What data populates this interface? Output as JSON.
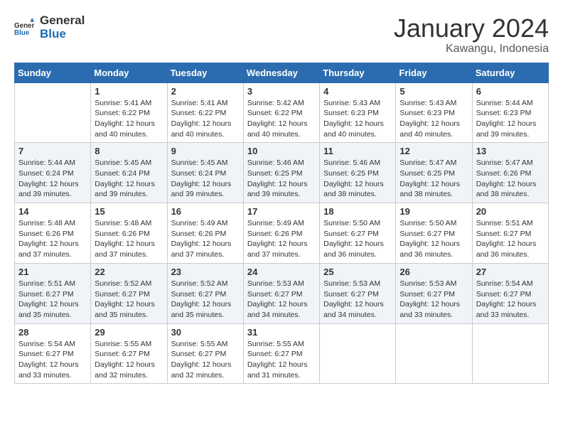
{
  "header": {
    "logo_general": "General",
    "logo_blue": "Blue",
    "month_year": "January 2024",
    "location": "Kawangu, Indonesia"
  },
  "days_of_week": [
    "Sunday",
    "Monday",
    "Tuesday",
    "Wednesday",
    "Thursday",
    "Friday",
    "Saturday"
  ],
  "weeks": [
    [
      {
        "day": "",
        "info": ""
      },
      {
        "day": "1",
        "info": "Sunrise: 5:41 AM\nSunset: 6:22 PM\nDaylight: 12 hours\nand 40 minutes."
      },
      {
        "day": "2",
        "info": "Sunrise: 5:41 AM\nSunset: 6:22 PM\nDaylight: 12 hours\nand 40 minutes."
      },
      {
        "day": "3",
        "info": "Sunrise: 5:42 AM\nSunset: 6:22 PM\nDaylight: 12 hours\nand 40 minutes."
      },
      {
        "day": "4",
        "info": "Sunrise: 5:43 AM\nSunset: 6:23 PM\nDaylight: 12 hours\nand 40 minutes."
      },
      {
        "day": "5",
        "info": "Sunrise: 5:43 AM\nSunset: 6:23 PM\nDaylight: 12 hours\nand 40 minutes."
      },
      {
        "day": "6",
        "info": "Sunrise: 5:44 AM\nSunset: 6:23 PM\nDaylight: 12 hours\nand 39 minutes."
      }
    ],
    [
      {
        "day": "7",
        "info": "Sunrise: 5:44 AM\nSunset: 6:24 PM\nDaylight: 12 hours\nand 39 minutes."
      },
      {
        "day": "8",
        "info": "Sunrise: 5:45 AM\nSunset: 6:24 PM\nDaylight: 12 hours\nand 39 minutes."
      },
      {
        "day": "9",
        "info": "Sunrise: 5:45 AM\nSunset: 6:24 PM\nDaylight: 12 hours\nand 39 minutes."
      },
      {
        "day": "10",
        "info": "Sunrise: 5:46 AM\nSunset: 6:25 PM\nDaylight: 12 hours\nand 39 minutes."
      },
      {
        "day": "11",
        "info": "Sunrise: 5:46 AM\nSunset: 6:25 PM\nDaylight: 12 hours\nand 38 minutes."
      },
      {
        "day": "12",
        "info": "Sunrise: 5:47 AM\nSunset: 6:25 PM\nDaylight: 12 hours\nand 38 minutes."
      },
      {
        "day": "13",
        "info": "Sunrise: 5:47 AM\nSunset: 6:26 PM\nDaylight: 12 hours\nand 38 minutes."
      }
    ],
    [
      {
        "day": "14",
        "info": "Sunrise: 5:48 AM\nSunset: 6:26 PM\nDaylight: 12 hours\nand 37 minutes."
      },
      {
        "day": "15",
        "info": "Sunrise: 5:48 AM\nSunset: 6:26 PM\nDaylight: 12 hours\nand 37 minutes."
      },
      {
        "day": "16",
        "info": "Sunrise: 5:49 AM\nSunset: 6:26 PM\nDaylight: 12 hours\nand 37 minutes."
      },
      {
        "day": "17",
        "info": "Sunrise: 5:49 AM\nSunset: 6:26 PM\nDaylight: 12 hours\nand 37 minutes."
      },
      {
        "day": "18",
        "info": "Sunrise: 5:50 AM\nSunset: 6:27 PM\nDaylight: 12 hours\nand 36 minutes."
      },
      {
        "day": "19",
        "info": "Sunrise: 5:50 AM\nSunset: 6:27 PM\nDaylight: 12 hours\nand 36 minutes."
      },
      {
        "day": "20",
        "info": "Sunrise: 5:51 AM\nSunset: 6:27 PM\nDaylight: 12 hours\nand 36 minutes."
      }
    ],
    [
      {
        "day": "21",
        "info": "Sunrise: 5:51 AM\nSunset: 6:27 PM\nDaylight: 12 hours\nand 35 minutes."
      },
      {
        "day": "22",
        "info": "Sunrise: 5:52 AM\nSunset: 6:27 PM\nDaylight: 12 hours\nand 35 minutes."
      },
      {
        "day": "23",
        "info": "Sunrise: 5:52 AM\nSunset: 6:27 PM\nDaylight: 12 hours\nand 35 minutes."
      },
      {
        "day": "24",
        "info": "Sunrise: 5:53 AM\nSunset: 6:27 PM\nDaylight: 12 hours\nand 34 minutes."
      },
      {
        "day": "25",
        "info": "Sunrise: 5:53 AM\nSunset: 6:27 PM\nDaylight: 12 hours\nand 34 minutes."
      },
      {
        "day": "26",
        "info": "Sunrise: 5:53 AM\nSunset: 6:27 PM\nDaylight: 12 hours\nand 33 minutes."
      },
      {
        "day": "27",
        "info": "Sunrise: 5:54 AM\nSunset: 6:27 PM\nDaylight: 12 hours\nand 33 minutes."
      }
    ],
    [
      {
        "day": "28",
        "info": "Sunrise: 5:54 AM\nSunset: 6:27 PM\nDaylight: 12 hours\nand 33 minutes."
      },
      {
        "day": "29",
        "info": "Sunrise: 5:55 AM\nSunset: 6:27 PM\nDaylight: 12 hours\nand 32 minutes."
      },
      {
        "day": "30",
        "info": "Sunrise: 5:55 AM\nSunset: 6:27 PM\nDaylight: 12 hours\nand 32 minutes."
      },
      {
        "day": "31",
        "info": "Sunrise: 5:55 AM\nSunset: 6:27 PM\nDaylight: 12 hours\nand 31 minutes."
      },
      {
        "day": "",
        "info": ""
      },
      {
        "day": "",
        "info": ""
      },
      {
        "day": "",
        "info": ""
      }
    ]
  ]
}
